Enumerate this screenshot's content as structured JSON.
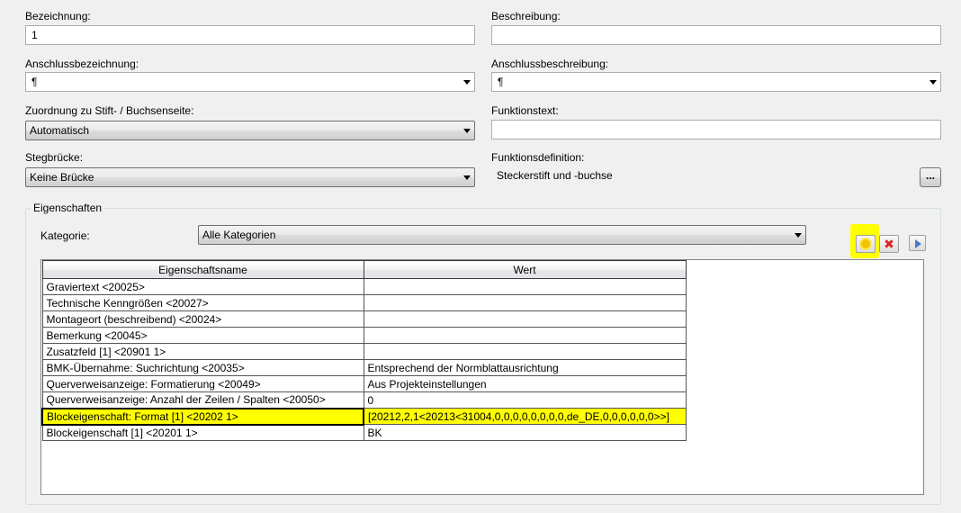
{
  "form": {
    "bezeichnung": {
      "label": "Bezeichnung:",
      "value": "1"
    },
    "beschreibung": {
      "label": "Beschreibung:",
      "value": ""
    },
    "anschlussbezeichnung": {
      "label": "Anschlussbezeichnung:",
      "value": "¶"
    },
    "anschlussbeschreibung": {
      "label": "Anschlussbeschreibung:",
      "value": "¶"
    },
    "zuordnung": {
      "label": "Zuordnung zu Stift- / Buchsenseite:",
      "value": "Automatisch"
    },
    "funktionstext": {
      "label": "Funktionstext:",
      "value": ""
    },
    "stegbruecke": {
      "label": "Stegbrücke:",
      "value": "Keine Brücke"
    },
    "funktionsdefinition": {
      "label": "Funktionsdefinition:",
      "value": "Steckerstift und -buchse",
      "button": "..."
    }
  },
  "properties": {
    "group_title": "Eigenschaften",
    "category_label": "Kategorie:",
    "category_value": "Alle Kategorien",
    "columns": [
      "Eigenschaftsname",
      "Wert"
    ],
    "rows": [
      {
        "name": "Graviertext <20025>",
        "value": ""
      },
      {
        "name": "Technische Kenngrößen <20027>",
        "value": ""
      },
      {
        "name": "Montageort (beschreibend) <20024>",
        "value": ""
      },
      {
        "name": "Bemerkung <20045>",
        "value": ""
      },
      {
        "name": "Zusatzfeld [1] <20901 1>",
        "value": ""
      },
      {
        "name": "BMK-Übernahme: Suchrichtung <20035>",
        "value": "Entsprechend der Normblattausrichtung"
      },
      {
        "name": "Querverweisanzeige: Formatierung <20049>",
        "value": "Aus Projekteinstellungen"
      },
      {
        "name": "Querverweisanzeige: Anzahl der Zeilen / Spalten <20050>",
        "value": "0"
      },
      {
        "name": "Blockeigenschaft: Format [1] <20202 1>",
        "value": "[20212,2,1<20213<31004,0,0,0,0,0,0,0,0,de_DE,0,0,0,0,0,0>>]",
        "selected": true
      },
      {
        "name": "Blockeigenschaft [1] <20201 1>",
        "value": "BK"
      }
    ]
  },
  "icons": {
    "new": "new-property-icon",
    "delete": "delete-property-icon",
    "play": "play-icon"
  },
  "colors": {
    "highlight": "#ffff00"
  }
}
